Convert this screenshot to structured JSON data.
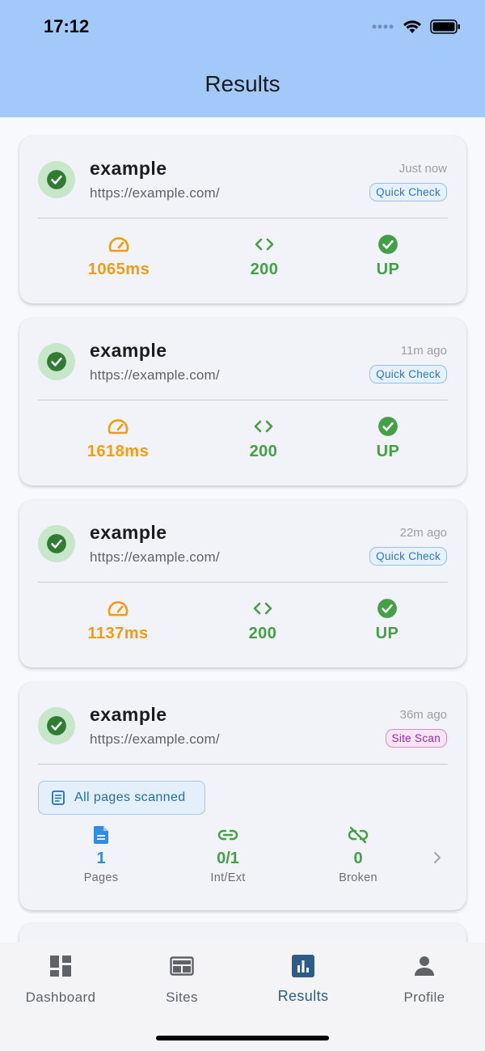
{
  "status_bar": {
    "time": "17:12"
  },
  "header": {
    "title": "Results"
  },
  "results": [
    {
      "name": "example",
      "url": "https://example.com/",
      "time_ago": "Just now",
      "tag": "Quick Check",
      "response_time": "1065ms",
      "status_code": "200",
      "status": "UP"
    },
    {
      "name": "example",
      "url": "https://example.com/",
      "time_ago": "11m ago",
      "tag": "Quick Check",
      "response_time": "1618ms",
      "status_code": "200",
      "status": "UP"
    },
    {
      "name": "example",
      "url": "https://example.com/",
      "time_ago": "22m ago",
      "tag": "Quick Check",
      "response_time": "1137ms",
      "status_code": "200",
      "status": "UP"
    },
    {
      "name": "example",
      "url": "https://example.com/",
      "time_ago": "36m ago",
      "tag": "Site Scan",
      "banner": "All pages scanned",
      "stats": [
        {
          "value": "1",
          "label": "Pages"
        },
        {
          "value": "0/1",
          "label": "Int/Ext"
        },
        {
          "value": "0",
          "label": "Broken"
        }
      ]
    }
  ],
  "tabbar": {
    "tabs": [
      {
        "label": "Dashboard",
        "icon": "dashboard-icon"
      },
      {
        "label": "Sites",
        "icon": "sites-icon"
      },
      {
        "label": "Results",
        "icon": "results-chart-icon",
        "active": true
      },
      {
        "label": "Profile",
        "icon": "person-icon"
      }
    ]
  },
  "colors": {
    "header": "#a3c9fb",
    "orange": "#f39c12",
    "green": "#43a047",
    "blue": "#2f8de4",
    "active_tab": "#2e5c86"
  }
}
